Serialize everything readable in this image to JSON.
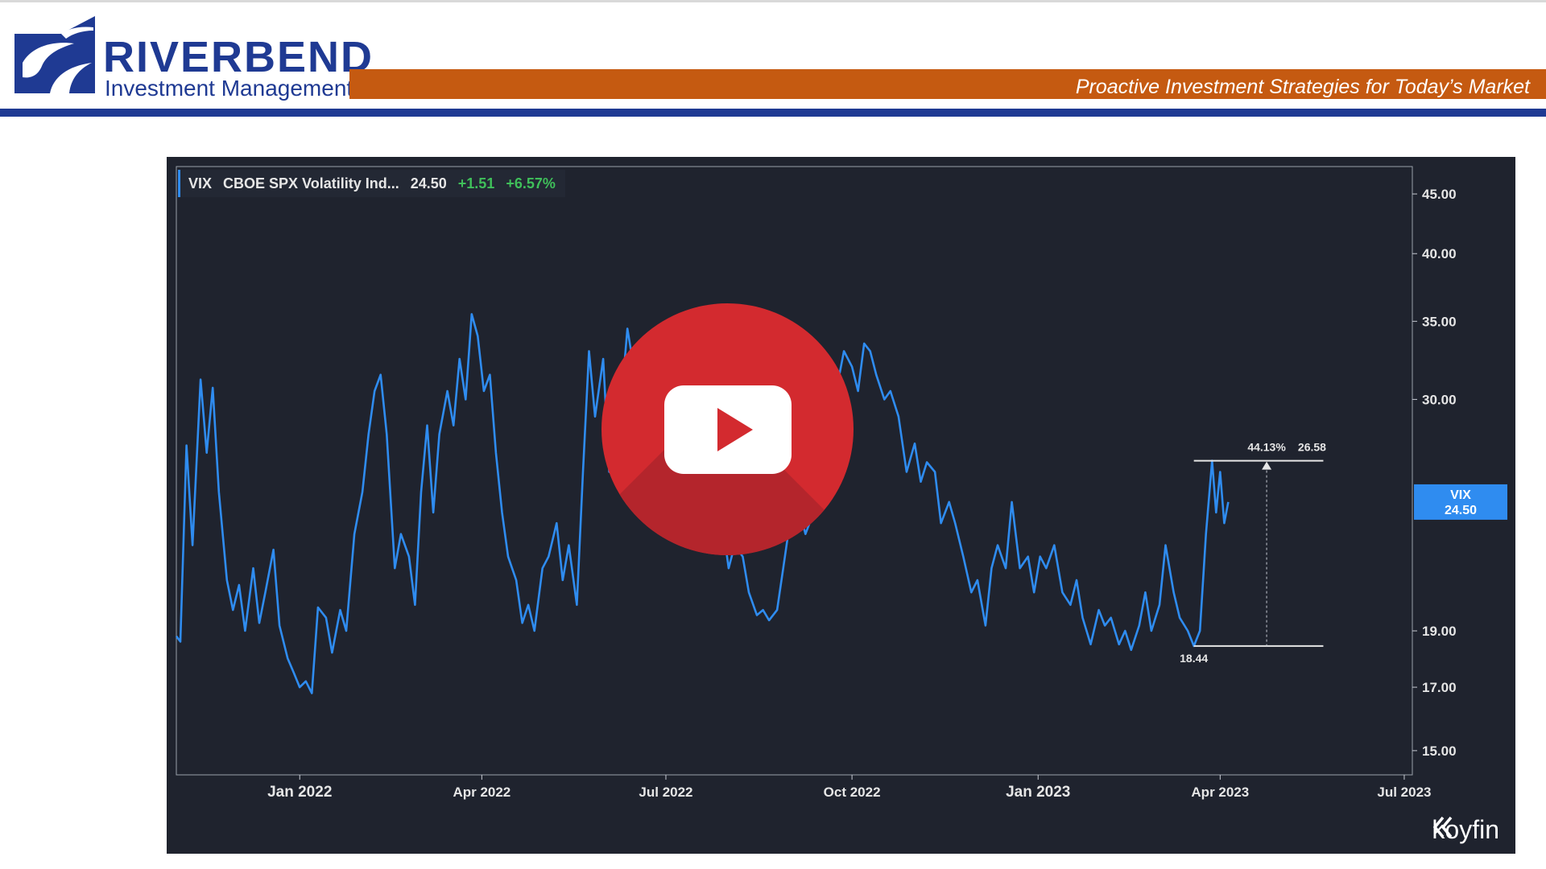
{
  "header": {
    "company_name": "RIVERBEND",
    "company_sub": "Investment Management",
    "tagline": "Proactive Investment Strategies for Today’s Market"
  },
  "colors": {
    "brand_blue": "#1f3a93",
    "brand_orange": "#c55a11",
    "chart_bg": "#1f232e",
    "line": "#2f8cf0",
    "positive": "#3fbf5a"
  },
  "chart_header": {
    "ticker": "VIX",
    "name": "CBOE SPX Volatility Ind...",
    "last": "24.50",
    "change": "+1.51",
    "change_pct": "+6.57%"
  },
  "branding": {
    "watermark": "koyfin"
  },
  "video": {
    "icon": "play-icon"
  },
  "chart_data": {
    "type": "line",
    "title": "",
    "xlabel": "",
    "ylabel": "",
    "y_scale": "log",
    "ylim": [
      14.3,
      47.5
    ],
    "y_ticks": [
      15,
      17,
      19,
      30,
      35,
      40,
      45
    ],
    "y_tick_labels": [
      "15.00",
      "17.00",
      "19.00",
      "30.00",
      "35.00",
      "40.00",
      "45.00"
    ],
    "x_ticks": [
      "2022-01-01",
      "2022-04-01",
      "2022-07-01",
      "2022-10-01",
      "2023-01-01",
      "2023-04-01",
      "2023-07-01"
    ],
    "x_tick_labels": [
      "Jan 2022",
      "Apr 2022",
      "Jul 2022",
      "Oct 2022",
      "Jan 2023",
      "Apr 2023",
      "Jul 2023"
    ],
    "x_range": [
      "2021-11-01",
      "2023-07-05"
    ],
    "grid": false,
    "series": [
      {
        "name": "VIX",
        "points": [
          [
            "2021-11-01",
            18.8
          ],
          [
            "2021-11-03",
            18.6
          ],
          [
            "2021-11-06",
            27.4
          ],
          [
            "2021-11-09",
            22.5
          ],
          [
            "2021-11-13",
            31.2
          ],
          [
            "2021-11-16",
            27.0
          ],
          [
            "2021-11-19",
            30.7
          ],
          [
            "2021-11-22",
            25.0
          ],
          [
            "2021-11-26",
            21.0
          ],
          [
            "2021-11-29",
            19.8
          ],
          [
            "2021-12-02",
            20.8
          ],
          [
            "2021-12-05",
            19.0
          ],
          [
            "2021-12-09",
            21.5
          ],
          [
            "2021-12-12",
            19.3
          ],
          [
            "2021-12-15",
            20.5
          ],
          [
            "2021-12-19",
            22.3
          ],
          [
            "2021-12-22",
            19.2
          ],
          [
            "2021-12-26",
            18.0
          ],
          [
            "2021-12-29",
            17.5
          ],
          [
            "2022-01-01",
            17.0
          ],
          [
            "2022-01-04",
            17.2
          ],
          [
            "2022-01-07",
            16.8
          ],
          [
            "2022-01-10",
            19.9
          ],
          [
            "2022-01-14",
            19.5
          ],
          [
            "2022-01-17",
            18.2
          ],
          [
            "2022-01-21",
            19.8
          ],
          [
            "2022-01-24",
            19.0
          ],
          [
            "2022-01-28",
            23.0
          ],
          [
            "2022-02-01",
            25.0
          ],
          [
            "2022-02-04",
            28.0
          ],
          [
            "2022-02-07",
            30.5
          ],
          [
            "2022-02-10",
            31.5
          ],
          [
            "2022-02-13",
            28.0
          ],
          [
            "2022-02-17",
            21.5
          ],
          [
            "2022-02-20",
            23.0
          ],
          [
            "2022-02-24",
            22.0
          ],
          [
            "2022-02-27",
            20.0
          ],
          [
            "2022-03-02",
            25.0
          ],
          [
            "2022-03-05",
            28.5
          ],
          [
            "2022-03-08",
            24.0
          ],
          [
            "2022-03-11",
            28.0
          ],
          [
            "2022-03-15",
            30.5
          ],
          [
            "2022-03-18",
            28.5
          ],
          [
            "2022-03-21",
            32.5
          ],
          [
            "2022-03-24",
            30.0
          ],
          [
            "2022-03-27",
            35.5
          ],
          [
            "2022-03-30",
            34.0
          ],
          [
            "2022-04-02",
            30.5
          ],
          [
            "2022-04-05",
            31.5
          ],
          [
            "2022-04-08",
            27.0
          ],
          [
            "2022-04-11",
            24.0
          ],
          [
            "2022-04-14",
            22.0
          ],
          [
            "2022-04-18",
            21.0
          ],
          [
            "2022-04-21",
            19.3
          ],
          [
            "2022-04-24",
            20.0
          ],
          [
            "2022-04-27",
            19.0
          ],
          [
            "2022-05-01",
            21.5
          ],
          [
            "2022-05-04",
            22.0
          ],
          [
            "2022-05-08",
            23.5
          ],
          [
            "2022-05-11",
            21.0
          ],
          [
            "2022-05-14",
            22.5
          ],
          [
            "2022-05-18",
            20.0
          ],
          [
            "2022-05-21",
            26.0
          ],
          [
            "2022-05-24",
            33.0
          ],
          [
            "2022-05-27",
            29.0
          ],
          [
            "2022-05-31",
            32.5
          ],
          [
            "2022-06-03",
            26.0
          ],
          [
            "2022-06-06",
            31.5
          ],
          [
            "2022-06-09",
            30.0
          ],
          [
            "2022-06-12",
            34.5
          ],
          [
            "2022-06-15",
            32.0
          ],
          [
            "2022-06-19",
            30.5
          ],
          [
            "2022-06-22",
            27.0
          ],
          [
            "2022-06-25",
            28.5
          ],
          [
            "2022-06-29",
            26.0
          ],
          [
            "2022-07-02",
            27.5
          ],
          [
            "2022-07-05",
            25.5
          ],
          [
            "2022-07-08",
            24.5
          ],
          [
            "2022-07-12",
            30.0
          ],
          [
            "2022-07-15",
            33.5
          ],
          [
            "2022-07-18",
            31.0
          ],
          [
            "2022-07-22",
            28.5
          ],
          [
            "2022-07-25",
            26.0
          ],
          [
            "2022-07-29",
            23.5
          ],
          [
            "2022-08-01",
            21.5
          ],
          [
            "2022-08-04",
            22.5
          ],
          [
            "2022-08-08",
            22.0
          ],
          [
            "2022-08-11",
            20.5
          ],
          [
            "2022-08-15",
            19.6
          ],
          [
            "2022-08-18",
            19.8
          ],
          [
            "2022-08-21",
            19.4
          ],
          [
            "2022-08-25",
            19.8
          ],
          [
            "2022-08-28",
            21.5
          ],
          [
            "2022-09-01",
            24.0
          ],
          [
            "2022-09-04",
            24.5
          ],
          [
            "2022-09-08",
            23.0
          ],
          [
            "2022-09-12",
            24.0
          ],
          [
            "2022-09-16",
            26.0
          ],
          [
            "2022-09-20",
            28.0
          ],
          [
            "2022-09-24",
            31.0
          ],
          [
            "2022-09-27",
            33.0
          ],
          [
            "2022-10-01",
            32.0
          ],
          [
            "2022-10-04",
            30.5
          ],
          [
            "2022-10-07",
            33.5
          ],
          [
            "2022-10-10",
            33.0
          ],
          [
            "2022-10-13",
            31.5
          ],
          [
            "2022-10-17",
            30.0
          ],
          [
            "2022-10-20",
            30.5
          ],
          [
            "2022-10-24",
            29.0
          ],
          [
            "2022-10-28",
            26.0
          ],
          [
            "2022-11-01",
            27.5
          ],
          [
            "2022-11-04",
            25.5
          ],
          [
            "2022-11-07",
            26.5
          ],
          [
            "2022-11-11",
            26.0
          ],
          [
            "2022-11-14",
            23.5
          ],
          [
            "2022-11-18",
            24.5
          ],
          [
            "2022-11-21",
            23.5
          ],
          [
            "2022-11-25",
            22.0
          ],
          [
            "2022-11-29",
            20.5
          ],
          [
            "2022-12-02",
            21.0
          ],
          [
            "2022-12-06",
            19.2
          ],
          [
            "2022-12-09",
            21.5
          ],
          [
            "2022-12-12",
            22.5
          ],
          [
            "2022-12-16",
            21.5
          ],
          [
            "2022-12-19",
            24.5
          ],
          [
            "2022-12-23",
            21.5
          ],
          [
            "2022-12-27",
            22.0
          ],
          [
            "2022-12-30",
            20.5
          ],
          [
            "2023-01-02",
            22.0
          ],
          [
            "2023-01-05",
            21.5
          ],
          [
            "2023-01-09",
            22.5
          ],
          [
            "2023-01-13",
            20.5
          ],
          [
            "2023-01-17",
            20.0
          ],
          [
            "2023-01-20",
            21.0
          ],
          [
            "2023-01-23",
            19.5
          ],
          [
            "2023-01-27",
            18.5
          ],
          [
            "2023-01-31",
            19.8
          ],
          [
            "2023-02-03",
            19.2
          ],
          [
            "2023-02-06",
            19.5
          ],
          [
            "2023-02-10",
            18.5
          ],
          [
            "2023-02-13",
            19.0
          ],
          [
            "2023-02-16",
            18.3
          ],
          [
            "2023-02-20",
            19.2
          ],
          [
            "2023-02-23",
            20.5
          ],
          [
            "2023-02-26",
            19.0
          ],
          [
            "2023-03-02",
            20.0
          ],
          [
            "2023-03-05",
            22.5
          ],
          [
            "2023-03-09",
            20.5
          ],
          [
            "2023-03-12",
            19.5
          ],
          [
            "2023-03-16",
            19.0
          ],
          [
            "2023-03-19",
            18.44
          ],
          [
            "2023-03-22",
            19.0
          ],
          [
            "2023-03-25",
            23.0
          ],
          [
            "2023-03-28",
            26.58
          ],
          [
            "2023-03-30",
            24.0
          ],
          [
            "2023-04-01",
            26.0
          ],
          [
            "2023-04-03",
            23.5
          ],
          [
            "2023-04-05",
            24.5
          ]
        ]
      }
    ],
    "last_value_tag": {
      "label": "VIX",
      "value": "24.50",
      "y": 24.5
    },
    "measurement": {
      "start_date": "2023-03-19",
      "end_date": "2023-05-22",
      "low": 18.44,
      "high": 26.58,
      "low_label": "18.44",
      "high_label": "26.58",
      "pct_label": "44.13%"
    }
  }
}
